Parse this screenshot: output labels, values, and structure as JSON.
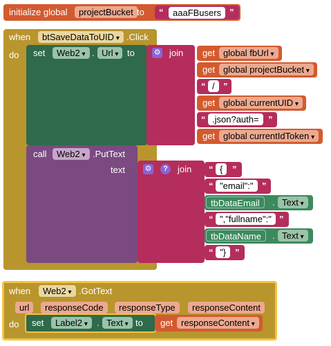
{
  "colors": {
    "variable": "#d35a2f",
    "variable_light": "#eca98f",
    "event": "#b9952e",
    "event_selected_border": "#f5c242",
    "setter": "#2f6a4a",
    "component_green": "#3c8a5e",
    "text": "#b52d5c",
    "text_light": "#ffffff",
    "method": "#7a4a80"
  },
  "global_init": {
    "label": "initialize global",
    "name": "projectBucket",
    "to": "to",
    "value": "aaaFBusers"
  },
  "click_event": {
    "when": "when",
    "component": "btSaveDataToUID",
    "event": ".Click",
    "do": "do",
    "set_block": {
      "set": "set",
      "component": "Web2",
      "dot": ".",
      "property": "Url",
      "to": "to",
      "join": "join",
      "items": [
        {
          "kind": "get",
          "get": "get",
          "var": "global fbUrl"
        },
        {
          "kind": "get",
          "get": "get",
          "var": "global projectBucket"
        },
        {
          "kind": "text",
          "value": "/"
        },
        {
          "kind": "get",
          "get": "get",
          "var": "global currentUID"
        },
        {
          "kind": "text",
          "value": ".json?auth="
        },
        {
          "kind": "get",
          "get": "get",
          "var": "global currentIdToken"
        }
      ]
    },
    "call_block": {
      "call": "call",
      "component": "Web2",
      "method": ".PutText",
      "text_label": "text",
      "join": "join",
      "items": [
        {
          "kind": "text",
          "value": "{"
        },
        {
          "kind": "text",
          "value": "\"email\":\""
        },
        {
          "kind": "prop",
          "component": "tbDataEmail",
          "dot": ".",
          "property": "Text"
        },
        {
          "kind": "text",
          "value": "\",\"fullname\":\""
        },
        {
          "kind": "prop",
          "component": "tbDataName",
          "dot": ".",
          "property": "Text"
        },
        {
          "kind": "text",
          "value": "\"}"
        }
      ]
    }
  },
  "gottext_event": {
    "when": "when",
    "component": "Web2",
    "event": ".GotText",
    "params": [
      "url",
      "responseCode",
      "responseType",
      "responseContent"
    ],
    "do": "do",
    "set_block": {
      "set": "set",
      "component": "Label2",
      "dot": ".",
      "property": "Text",
      "to": "to",
      "get": "get",
      "var": "responseContent"
    }
  }
}
